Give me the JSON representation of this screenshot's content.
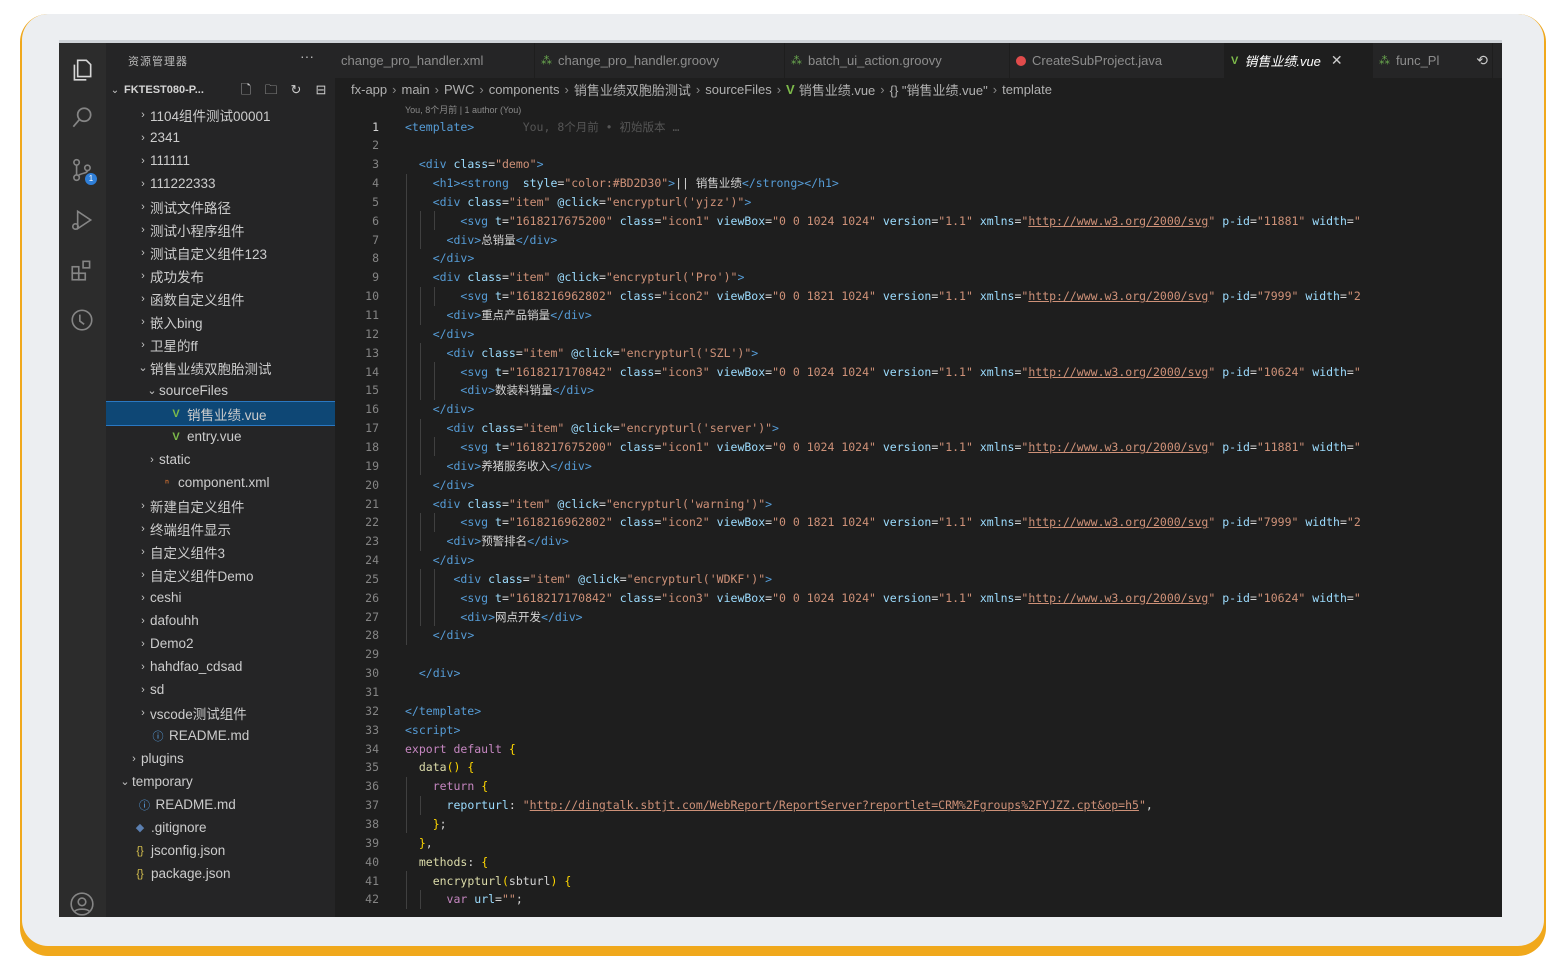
{
  "sidebar": {
    "title": "资源管理器",
    "more": "···",
    "workspace": "FKTEST080-P...",
    "tree": [
      {
        "label": "1104组件测试00001",
        "depth": 2,
        "twisty": ">",
        "icon": ""
      },
      {
        "label": "2341",
        "depth": 2,
        "twisty": ">",
        "icon": ""
      },
      {
        "label": "111111",
        "depth": 2,
        "twisty": ">",
        "icon": ""
      },
      {
        "label": "111222333",
        "depth": 2,
        "twisty": ">",
        "icon": ""
      },
      {
        "label": "测试文件路径",
        "depth": 2,
        "twisty": ">",
        "icon": ""
      },
      {
        "label": "测试小程序组件",
        "depth": 2,
        "twisty": ">",
        "icon": ""
      },
      {
        "label": "测试自定义组件123",
        "depth": 2,
        "twisty": ">",
        "icon": ""
      },
      {
        "label": "成功发布",
        "depth": 2,
        "twisty": ">",
        "icon": ""
      },
      {
        "label": "函数自定义组件",
        "depth": 2,
        "twisty": ">",
        "icon": ""
      },
      {
        "label": "嵌入bing",
        "depth": 2,
        "twisty": ">",
        "icon": ""
      },
      {
        "label": "卫星的ff",
        "depth": 2,
        "twisty": ">",
        "icon": ""
      },
      {
        "label": "销售业绩双胞胎测试",
        "depth": 2,
        "twisty": "v",
        "icon": ""
      },
      {
        "label": "sourceFiles",
        "depth": 3,
        "twisty": "v",
        "icon": ""
      },
      {
        "label": "销售业绩.vue",
        "depth": 4,
        "twisty": "",
        "icon": "vue",
        "selected": true
      },
      {
        "label": "entry.vue",
        "depth": 4,
        "twisty": "",
        "icon": "vue"
      },
      {
        "label": "static",
        "depth": 3,
        "twisty": ">",
        "icon": ""
      },
      {
        "label": "component.xml",
        "depth": 3,
        "twisty": "",
        "icon": "xml"
      },
      {
        "label": "新建自定义组件",
        "depth": 2,
        "twisty": ">",
        "icon": ""
      },
      {
        "label": "终端组件显示",
        "depth": 2,
        "twisty": ">",
        "icon": ""
      },
      {
        "label": "自定义组件3",
        "depth": 2,
        "twisty": ">",
        "icon": ""
      },
      {
        "label": "自定义组件Demo",
        "depth": 2,
        "twisty": ">",
        "icon": ""
      },
      {
        "label": "ceshi",
        "depth": 2,
        "twisty": ">",
        "icon": ""
      },
      {
        "label": "dafouhh",
        "depth": 2,
        "twisty": ">",
        "icon": ""
      },
      {
        "label": "Demo2",
        "depth": 2,
        "twisty": ">",
        "icon": ""
      },
      {
        "label": "hahdfao_cdsad",
        "depth": 2,
        "twisty": ">",
        "icon": ""
      },
      {
        "label": "sd",
        "depth": 2,
        "twisty": ">",
        "icon": ""
      },
      {
        "label": "vscode测试组件",
        "depth": 2,
        "twisty": ">",
        "icon": ""
      },
      {
        "label": "README.md",
        "depth": 2,
        "twisty": "",
        "icon": "info"
      },
      {
        "label": "plugins",
        "depth": 1,
        "twisty": ">",
        "icon": ""
      },
      {
        "label": "temporary",
        "depth": 0,
        "twisty": "v",
        "icon": ""
      },
      {
        "label": "README.md",
        "depth": 0.5,
        "twisty": "",
        "icon": "info"
      },
      {
        "label": ".gitignore",
        "depth": 0,
        "twisty": "",
        "icon": "git"
      },
      {
        "label": "jsconfig.json",
        "depth": 0,
        "twisty": "",
        "icon": "json"
      },
      {
        "label": "package.json",
        "depth": 0,
        "twisty": "",
        "icon": "json"
      }
    ]
  },
  "tabs": [
    {
      "label": "change_pro_handler.xml",
      "icon": ""
    },
    {
      "label": "change_pro_handler.groovy",
      "icon": "groovy"
    },
    {
      "label": "batch_ui_action.groovy",
      "icon": "groovy"
    },
    {
      "label": "CreateSubProject.java",
      "icon": "java"
    },
    {
      "label": "销售业绩.vue",
      "icon": "vue",
      "active": true
    },
    {
      "label": "func_Pl",
      "icon": "groovy"
    }
  ],
  "breadcrumbs": [
    "fx-app",
    "main",
    "PWC",
    "components",
    "销售业绩双胞胎测试",
    "sourceFiles",
    "销售业绩.vue",
    "{} \"销售业绩.vue\"",
    "template"
  ],
  "blame": "You, 8个月前 | 1 author (You)",
  "code_lines": [
    "<template>       You, 8个月前 • 初始版本 …",
    "",
    "  <div class=\"demo\">",
    "    <h1><strong  style=\"color:#BD2D30\">|| 销售业绩</strong></h1>",
    "    <div class=\"item\" @click=\"encrypturl('yjzz')\">",
    "        <svg t=\"1618217675200\" class=\"icon1\" viewBox=\"0 0 1024 1024\" version=\"1.1\" xmlns=\"http://www.w3.org/2000/svg\" p-id=\"11881\" width=\"",
    "      <div>总销量</div>",
    "    </div>",
    "    <div class=\"item\" @click=\"encrypturl('Pro')\">",
    "        <svg t=\"1618216962802\" class=\"icon2\" viewBox=\"0 0 1821 1024\" version=\"1.1\" xmlns=\"http://www.w3.org/2000/svg\" p-id=\"7999\" width=\"2",
    "      <div>重点产品销量</div>",
    "    </div>",
    "      <div class=\"item\" @click=\"encrypturl('SZL')\">",
    "        <svg t=\"1618217170842\" class=\"icon3\" viewBox=\"0 0 1024 1024\" version=\"1.1\" xmlns=\"http://www.w3.org/2000/svg\" p-id=\"10624\" width=\"",
    "        <div>数装料销量</div>",
    "    </div>",
    "      <div class=\"item\" @click=\"encrypturl('server')\">",
    "        <svg t=\"1618217675200\" class=\"icon1\" viewBox=\"0 0 1024 1024\" version=\"1.1\" xmlns=\"http://www.w3.org/2000/svg\" p-id=\"11881\" width=\"",
    "      <div>养猪服务收入</div>",
    "    </div>",
    "    <div class=\"item\" @click=\"encrypturl('warning')\">",
    "        <svg t=\"1618216962802\" class=\"icon2\" viewBox=\"0 0 1821 1024\" version=\"1.1\" xmlns=\"http://www.w3.org/2000/svg\" p-id=\"7999\" width=\"2",
    "      <div>预警排名</div>",
    "    </div>",
    "       <div class=\"item\" @click=\"encrypturl('WDKF')\">",
    "        <svg t=\"1618217170842\" class=\"icon3\" viewBox=\"0 0 1024 1024\" version=\"1.1\" xmlns=\"http://www.w3.org/2000/svg\" p-id=\"10624\" width=\"",
    "        <div>网点开发</div>",
    "    </div>",
    "",
    "  </div>",
    "",
    "</template>",
    "<script>",
    "export default {",
    "  data() {",
    "    return {",
    "      reporturl: \"http://dingtalk.sbtjt.com/WebReport/ReportServer?reportlet=CRM%2Fgroups%2FYJZZ.cpt&op=h5\",",
    "    };",
    "  },",
    "  methods: {",
    "    encrypturl(sbturl) {",
    "      var url=\"\";"
  ]
}
